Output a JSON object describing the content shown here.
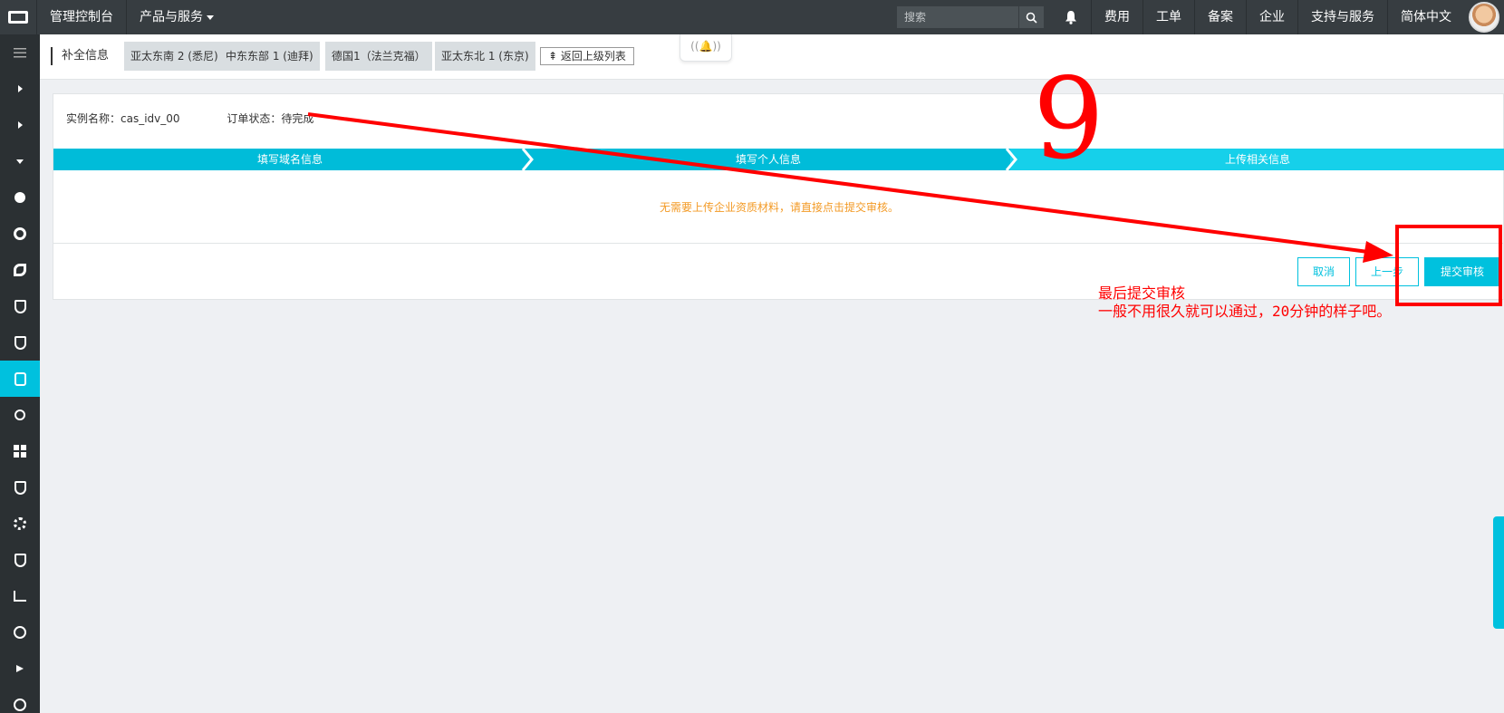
{
  "topbar": {
    "console_label": "管理控制台",
    "products_label": "产品与服务",
    "search_placeholder": "搜索",
    "nav": [
      "费用",
      "工单",
      "备案",
      "企业",
      "支持与服务",
      "简体中文"
    ]
  },
  "subheader": {
    "title": "补全信息",
    "regions": [
      "亚太东南 2 (悉尼)",
      "中东东部 1 (迪拜)",
      "德国1（法兰克福）",
      "亚太东北 1 (东京)"
    ],
    "back_label": "返回上级列表",
    "back_icon": "⇞"
  },
  "order": {
    "instance_label": "实例名称：cas_idv_00",
    "status_label": "订单状态：待完成"
  },
  "steps": [
    "填写域名信息",
    "填写个人信息",
    "上传相关信息"
  ],
  "notice": "无需要上传企业资质材料，请直接点击提交审核。",
  "buttons": {
    "cancel": "取消",
    "prev": "上一步",
    "submit": "提交审核"
  },
  "annotation": {
    "step_number": "9",
    "line1": "最后提交审核",
    "line2": "一般不用很久就可以通过，20分钟的样子吧。"
  },
  "colors": {
    "topbar": "#373d41",
    "sidebar": "#2b3033",
    "accent": "#00c1de",
    "notice": "#f39a25",
    "annotation": "#ff0000"
  },
  "icons": {
    "logo": "aliyun-logo",
    "search": "search-icon",
    "bell": "bell-icon"
  }
}
